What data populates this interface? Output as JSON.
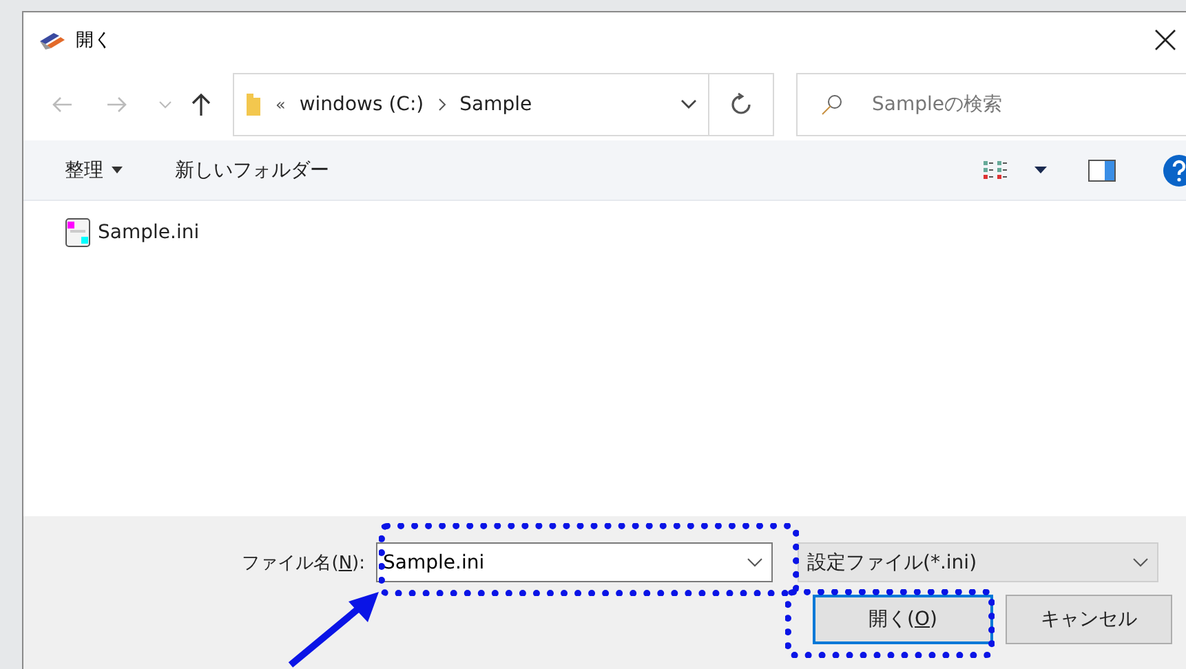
{
  "window": {
    "title": "開く"
  },
  "nav": {
    "path": [
      {
        "label": "windows (C:)"
      },
      {
        "label": "Sample"
      }
    ],
    "overflow": "«",
    "search": {
      "placeholder": "Sampleの検索"
    }
  },
  "toolbar": {
    "organize": "整理",
    "new_folder": "新しいフォルダー"
  },
  "files": [
    {
      "name": "Sample.ini"
    }
  ],
  "filename": {
    "label": "ファイル名(",
    "accel": "N",
    "tail": "):",
    "value": "Sample.ini"
  },
  "filter": {
    "value": "設定ファイル(*.ini)"
  },
  "buttons": [
    {
      "label": "開く(",
      "accel": "O",
      "tail": ")",
      "kind": "default"
    },
    {
      "label": "キャンセル",
      "kind": "normal"
    }
  ]
}
